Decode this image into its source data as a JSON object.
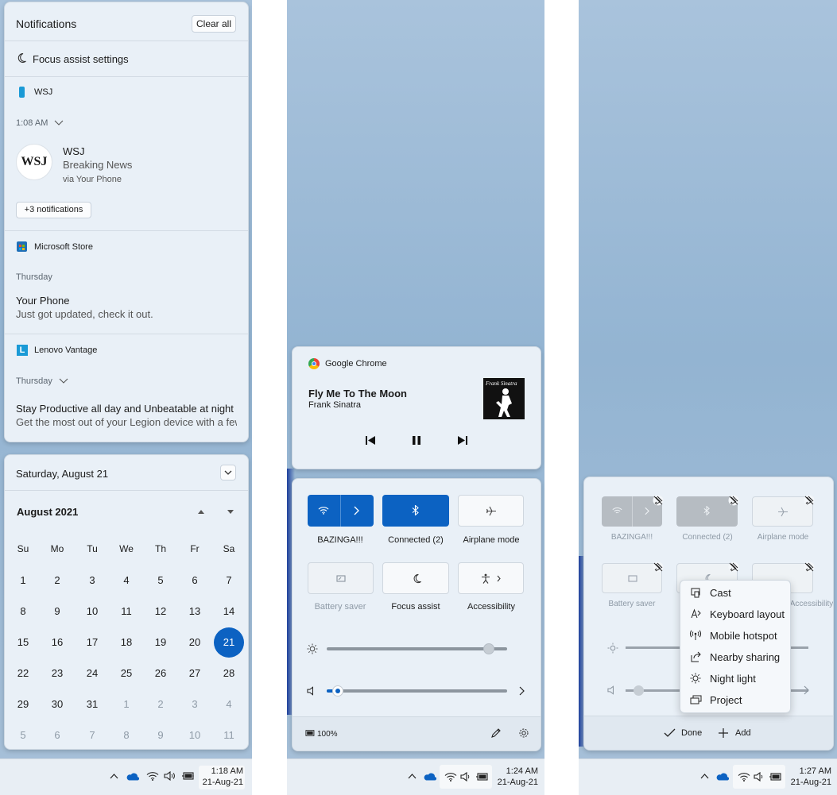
{
  "left": {
    "notifications": {
      "title": "Notifications",
      "clear_all": "Clear all",
      "focus_assist": "Focus assist settings",
      "groups": [
        {
          "app": "WSJ",
          "time": "1:08 AM",
          "logo": "WSJ",
          "title": "WSJ",
          "line1": "Breaking News",
          "line2": "via Your Phone",
          "more": "+3 notifications"
        },
        {
          "app": "Microsoft Store",
          "time": "Thursday",
          "title": "Your Phone",
          "line1": "Just got updated, check it out."
        },
        {
          "app": "Lenovo Vantage",
          "app_icon_letter": "L",
          "time": "Thursday",
          "title": "Stay Productive all day and Unbeatable at night",
          "line1": "Get the most out of your Legion device with a few"
        }
      ]
    },
    "calendar": {
      "date_header": "Saturday, August 21",
      "month": "August 2021",
      "weekdays": [
        "Su",
        "Mo",
        "Tu",
        "We",
        "Th",
        "Fr",
        "Sa"
      ],
      "weeks": [
        [
          "1",
          "2",
          "3",
          "4",
          "5",
          "6",
          "7"
        ],
        [
          "8",
          "9",
          "10",
          "11",
          "12",
          "13",
          "14"
        ],
        [
          "15",
          "16",
          "17",
          "18",
          "19",
          "20",
          "21"
        ],
        [
          "22",
          "23",
          "24",
          "25",
          "26",
          "27",
          "28"
        ],
        [
          "29",
          "30",
          "31",
          "1",
          "2",
          "3",
          "4"
        ],
        [
          "5",
          "6",
          "7",
          "8",
          "9",
          "10",
          "11"
        ]
      ],
      "selected": "21"
    },
    "clock": {
      "time": "1:18 AM",
      "date": "21-Aug-21"
    }
  },
  "middle": {
    "media": {
      "source": "Google Chrome",
      "song": "Fly Me To The Moon",
      "artist": "Frank Sinatra",
      "album_art_text": "Frank Sinatra"
    },
    "quick": {
      "tiles": [
        {
          "label": "BAZINGA!!!",
          "icon": "wifi-icon",
          "state": "on"
        },
        {
          "label": "Connected (2)",
          "icon": "bluetooth-icon",
          "state": "on"
        },
        {
          "label": "Airplane mode",
          "icon": "airplane-icon",
          "state": "off"
        },
        {
          "label": "Battery saver",
          "icon": "battery-saver-icon",
          "state": "disabled"
        },
        {
          "label": "Focus assist",
          "icon": "moon-icon",
          "state": "off"
        },
        {
          "label": "Accessibility",
          "icon": "accessibility-icon",
          "state": "off"
        }
      ],
      "brightness": 0.9,
      "volume": 0.06,
      "battery": "100%"
    },
    "clock": {
      "time": "1:24 AM",
      "date": "21-Aug-21"
    }
  },
  "right": {
    "quick": {
      "tiles": [
        {
          "label": "BAZINGA!!!"
        },
        {
          "label": "Connected (2)"
        },
        {
          "label": "Airplane mode"
        },
        {
          "label": "Battery saver"
        },
        {
          "label": "Accessibility"
        }
      ],
      "add_menu": [
        "Cast",
        "Keyboard layout",
        "Mobile hotspot",
        "Nearby sharing",
        "Night light",
        "Project"
      ],
      "done": "Done",
      "add": "Add"
    },
    "clock": {
      "time": "1:27 AM",
      "date": "21-Aug-21"
    }
  },
  "colors": {
    "accent": "#0c62c2",
    "panel_bg": "#e9f0f7"
  }
}
